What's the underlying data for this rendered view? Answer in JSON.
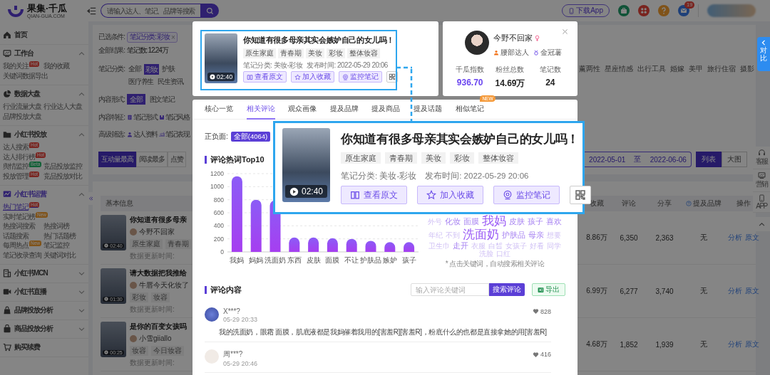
{
  "header": {
    "logo_title": "果集·千瓜",
    "logo_subtitle": "QIAN-GUA.COM",
    "search": {
      "placeholder": "请输入达人、笔记、品牌等搜索"
    },
    "download_button": "下载App",
    "mail_badge": "19"
  },
  "sidebar": {
    "sections": [
      {
        "title": "首页",
        "kind": "link",
        "selected": false
      },
      {
        "title": "工作台",
        "kind": "group",
        "expanded": true,
        "selected": false,
        "items": [
          {
            "label": "我的关注",
            "selected": false,
            "badge": {
              "text": "Hot",
              "kind": "hot"
            }
          },
          {
            "label": "我的收藏",
            "selected": false
          },
          {
            "label": "关键词数据导出",
            "selected": false
          }
        ]
      },
      {
        "title": "数据大盘",
        "kind": "group",
        "expanded": true,
        "selected": false,
        "items": [
          {
            "label": "行业流量大盘",
            "selected": false
          },
          {
            "label": "行业达人大盘",
            "selected": false
          },
          {
            "label": "品牌投放大盘",
            "selected": false
          }
        ]
      },
      {
        "title": "小红书投放",
        "kind": "group",
        "expanded": true,
        "selected": false,
        "items": [
          {
            "label": "达人搜索",
            "selected": false,
            "badge": {
              "text": "Hot",
              "kind": "hot"
            }
          },
          {
            "label": "达人排行榜",
            "selected": false,
            "badge": {
              "text": "Hot",
              "kind": "hot"
            }
          },
          {
            "label": "舆情监控",
            "selected": false,
            "badge": {
              "text": "Beta",
              "kind": "beta"
            }
          },
          {
            "label": "竞品投放监控",
            "selected": false
          },
          {
            "label": "投放管理",
            "selected": false,
            "badge": {
              "text": "Hot",
              "kind": "hot"
            }
          },
          {
            "label": "竞品投放对比",
            "selected": false
          }
        ]
      },
      {
        "title": "小红书运营",
        "kind": "group",
        "expanded": true,
        "selected": true,
        "items": [
          {
            "label": "热门笔记",
            "selected": true,
            "badge": {
              "text": "Hot",
              "kind": "hot"
            }
          },
          {
            "label": "实时笔记榜",
            "selected": false,
            "badge": {
              "text": "New",
              "kind": "new"
            }
          },
          {
            "label": "热搜词搜索",
            "selected": false
          },
          {
            "label": "热搜词榜",
            "selected": false
          },
          {
            "label": "话题搜索",
            "selected": false
          },
          {
            "label": "热门话题榜",
            "selected": false
          },
          {
            "label": "每周热点",
            "selected": false,
            "badge": {
              "text": "New",
              "kind": "new"
            }
          },
          {
            "label": "笔记监控",
            "selected": false
          },
          {
            "label": "笔记收录查询",
            "selected": false
          },
          {
            "label": "关键词对比",
            "selected": false
          }
        ]
      },
      {
        "title": "小红书MCN",
        "kind": "group",
        "expanded": false,
        "selected": false
      },
      {
        "title": "小红书直播",
        "kind": "group",
        "expanded": false,
        "selected": false
      },
      {
        "title": "品牌投放分析",
        "kind": "group",
        "expanded": false,
        "selected": false
      },
      {
        "title": "商品投放分析",
        "kind": "group",
        "expanded": false,
        "selected": false
      },
      {
        "title": "购买续费",
        "kind": "link",
        "selected": false
      }
    ]
  },
  "filters": {
    "selected": {
      "label": "已选条件:",
      "chip": "笔记分类: 彩妆",
      "chip_close": "×"
    },
    "result": {
      "label": "全部结果:",
      "value": "笔记数: 12.24万"
    },
    "category": {
      "label": "笔记分类:",
      "options": [
        {
          "label": "全部",
          "selected": false
        },
        {
          "label": "彩妆",
          "selected": true
        },
        {
          "label": "护肤",
          "selected": false
        },
        {
          "label": "医疗养生",
          "selected": false
        },
        {
          "label": "民生资讯",
          "selected": false
        }
      ],
      "options_right": [
        "薰两性",
        "星座情感",
        "出行工具",
        "婚嫁",
        "美甲",
        "旅行住宿",
        "摄影"
      ]
    },
    "content_form": {
      "label": "内容形式:",
      "options": [
        {
          "label": "全部",
          "selected": true
        },
        {
          "label": "图文笔记",
          "selected": false
        }
      ]
    },
    "content_features": {
      "label": "内容特征:",
      "options": [
        "笔记形式",
        "笔记风格"
      ]
    },
    "advanced": {
      "label": "高级筛选:",
      "options": [
        "达人资料",
        "笔记表现"
      ]
    },
    "sort_tabs": [
      {
        "label": "互动量最高",
        "selected": true
      },
      {
        "label": "阅读最多",
        "selected": false
      },
      {
        "label": "点赞",
        "selected": false
      }
    ],
    "date_range": {
      "start": "2022-05-01",
      "separator": "至",
      "end": "2022-06-06"
    },
    "view_toggle": [
      {
        "label": "列表",
        "selected": true
      },
      {
        "label": "大图",
        "selected": false
      }
    ]
  },
  "table": {
    "columns": [
      "基本信息",
      "收藏",
      "评论",
      "分享",
      "提及品牌",
      "操作"
    ],
    "rows": [
      {
        "title": "你知道有很多母亲",
        "author": "今野不回家",
        "tags": [
          "原生家庭",
          "青春期"
        ],
        "updated": "数据更新时间:",
        "duration": "02:40",
        "collects": "8.86万",
        "comments": "6,350",
        "shares": "2,363",
        "brands": "无",
        "actions": [
          "分析",
          "原文"
        ]
      },
      {
        "title": "请大数据把我推给",
        "author": "牛唇今天化妆了",
        "tags": [
          "彩妆",
          "妆容"
        ],
        "updated": "数据更新时间:",
        "duration": "01:30",
        "collects": "6.99万",
        "comments": "6,277",
        "shares": "3,740",
        "brands": "无",
        "actions": [
          "分析",
          "原文"
        ]
      },
      {
        "title": "是你的百变女孩吗",
        "author": "小雪giiallo",
        "tags": [
          "妆容",
          "今日妆容"
        ],
        "updated": "数据更新时间:",
        "duration": "00:25",
        "collects": "4.68万",
        "comments": "1,852",
        "shares": "1,939",
        "brands": "无",
        "actions": [
          "分析",
          "原文"
        ]
      }
    ]
  },
  "note_card": {
    "title": "你知道有很多母亲其实会嫉妒自己的女儿吗！",
    "tags": [
      "原生家庭",
      "青春期",
      "美妆",
      "彩妆",
      "整体妆容"
    ],
    "category": "笔记分类: 美妆-彩妆",
    "published": "发布时间: 2022-05-29 20:06",
    "duration": "02:40",
    "buttons": [
      "查看原文",
      "加入收藏",
      "监控笔记"
    ]
  },
  "author_card": {
    "name": "今野不回家",
    "tier": "腰部达人",
    "badge": "金冠薯",
    "stats": [
      {
        "label": "千瓜指数",
        "value": "936.70",
        "color": "#6a45f0"
      },
      {
        "label": "粉丝总数",
        "value": "14.69万",
        "color": "#222222"
      },
      {
        "label": "笔记数",
        "value": "24",
        "color": "#222222"
      }
    ]
  },
  "detail": {
    "tabs": [
      {
        "label": "核心一览",
        "selected": false
      },
      {
        "label": "相关评论",
        "selected": true
      },
      {
        "label": "观众画像",
        "selected": false
      },
      {
        "label": "提及品牌",
        "selected": false
      },
      {
        "label": "提及商品",
        "selected": false
      },
      {
        "label": "提及话题",
        "selected": false
      },
      {
        "label": "相似笔记",
        "selected": false,
        "badge": "NEW"
      }
    ],
    "sentiment": {
      "label": "正负面:",
      "options": [
        {
          "label": "全部(4064)",
          "selected": true
        }
      ]
    },
    "chart_data": {
      "type": "bar",
      "title": "评论热词Top10",
      "categories": [
        "我妈",
        "妈妈",
        "洗面奶",
        "东西",
        "皮肤",
        "面膜",
        "不让",
        "护肤品",
        "嫉妒",
        "孩子"
      ],
      "values": [
        1160,
        800,
        790,
        220,
        220,
        210,
        200,
        170,
        150,
        150
      ],
      "ylim": [
        0,
        1200
      ],
      "grid": true,
      "yticks": [
        0,
        200,
        400,
        600,
        800,
        1000,
        1200
      ]
    },
    "word_cloud": {
      "words": [
        {
          "text": "外号",
          "kind": "small"
        },
        {
          "text": "化妆",
          "kind": "mid"
        },
        {
          "text": "面膜",
          "kind": "mid"
        },
        {
          "text": "我妈",
          "kind": "big"
        },
        {
          "text": "皮肤",
          "kind": "mid"
        },
        {
          "text": "孩子",
          "kind": "mid"
        },
        {
          "text": "喜欢",
          "kind": "mid"
        },
        {
          "text": "年纪",
          "kind": "small"
        },
        {
          "text": "不到",
          "kind": "small"
        },
        {
          "text": "洗面奶",
          "kind": "big"
        },
        {
          "text": "护肤品",
          "kind": "mid"
        },
        {
          "text": "母亲",
          "kind": "mid"
        },
        {
          "text": "想要",
          "kind": "small"
        },
        {
          "text": "卫生巾",
          "kind": "small"
        },
        {
          "text": "走开",
          "kind": "mid"
        },
        {
          "text": "衣服",
          "kind": "small"
        },
        {
          "text": "白皙",
          "kind": "small"
        },
        {
          "text": "女孩子",
          "kind": "small"
        },
        {
          "text": "好看",
          "kind": "small"
        },
        {
          "text": "同学",
          "kind": "small"
        },
        {
          "text": "洗脸",
          "kind": "small"
        },
        {
          "text": "口红",
          "kind": "small"
        }
      ],
      "note": "* 点击关键词，自动搜索相关评论"
    },
    "comments_title": "评论内容",
    "comment_search": {
      "placeholder": "输入评论关键词"
    },
    "search_button": "搜索评论",
    "export_button": "导出",
    "comments": [
      {
        "user": "X***?",
        "time": "05-29 20:33",
        "likes": "828",
        "text": "我的洗面奶，眼霜 面膜，肌底液都是我妈催着我用的[害羞R][害羞R]，粉底什么的也都是直接拿她的用[害羞R]"
      },
      {
        "user": "周***?",
        "time": "05-29 20:46",
        "likes": "416"
      }
    ]
  },
  "callout": {
    "title": "你知道有很多母亲其实会嫉妒自己的女儿吗！",
    "tags": [
      "原生家庭",
      "青春期",
      "美妆",
      "彩妆",
      "整体妆容"
    ],
    "category": "笔记分类: 美妆-彩妆",
    "published": "发布时间: 2022-05-29 20:06",
    "duration": "02:40",
    "buttons": [
      "查看原文",
      "加入收藏",
      "监控笔记"
    ]
  },
  "compare_tab": "对比",
  "side_tools": [
    "客服",
    "营销",
    "APP"
  ]
}
